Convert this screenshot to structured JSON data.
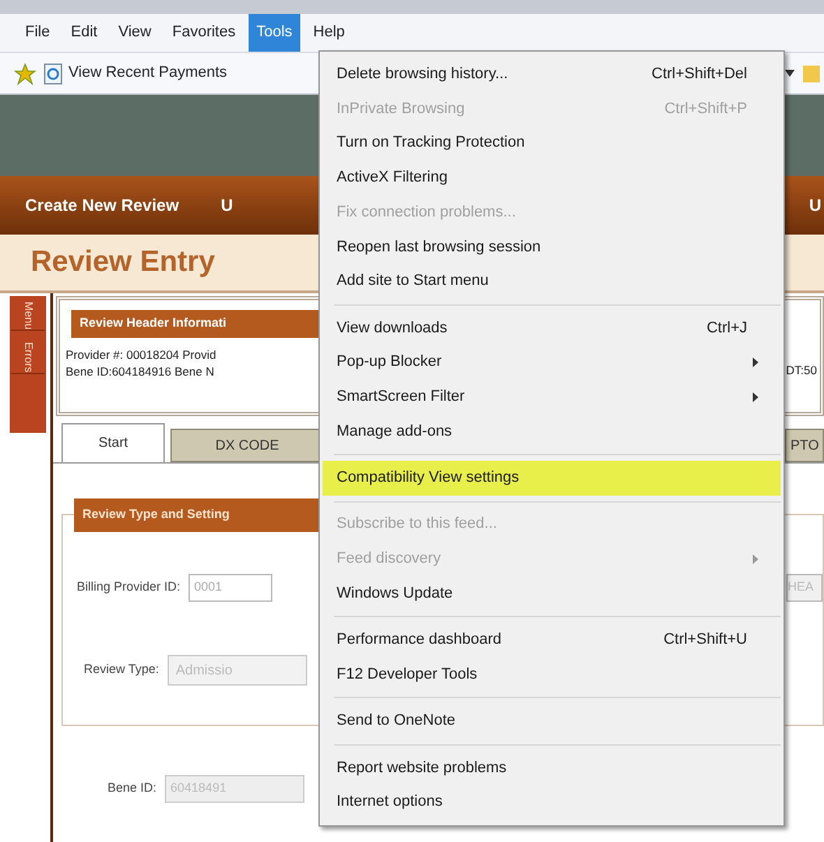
{
  "menu_bar": [
    {
      "label": "File",
      "selected": false
    },
    {
      "label": "Edit",
      "selected": false
    },
    {
      "label": "View",
      "selected": false
    },
    {
      "label": "Favorites",
      "selected": false
    },
    {
      "label": "Tools",
      "selected": true
    },
    {
      "label": "Help",
      "selected": false
    }
  ],
  "toolbar": {
    "link": "View Recent Payments"
  },
  "nav_bar": {
    "items": [
      "Create New Review",
      "U"
    ],
    "right_item": "U"
  },
  "page_title": "Review Entry",
  "side_tabs": [
    "Menu",
    "Errors"
  ],
  "header_panel": {
    "title": "Review Header Informati",
    "lines": [
      "Provider #: 00018204 Provid",
      "Bene ID:604184916 Bene N"
    ],
    "right_text": "DT:50"
  },
  "tabs": [
    {
      "label": "Start",
      "selected": true
    },
    {
      "label": "DX CODE",
      "selected": false
    }
  ],
  "right_tab": "PTO",
  "review_type_panel": {
    "title": "Review Type and Setting",
    "billing_provider": {
      "label": "Billing Provider ID:",
      "value": "0001"
    },
    "right_field_value": "HEA",
    "review_type": {
      "label": "Review Type:",
      "value": "Admissio"
    }
  },
  "bene_id": {
    "label": "Bene ID:",
    "value": "60418491"
  },
  "tools_menu": [
    {
      "kind": "item",
      "label": "Delete browsing history...",
      "shortcut": "Ctrl+Shift+Del",
      "disabled": false,
      "submenu": false,
      "selected": false
    },
    {
      "kind": "item",
      "label": "InPrivate Browsing",
      "shortcut": "Ctrl+Shift+P",
      "disabled": true,
      "submenu": false,
      "selected": false
    },
    {
      "kind": "item",
      "label": "Turn on Tracking Protection",
      "disabled": false,
      "submenu": false,
      "selected": false
    },
    {
      "kind": "item",
      "label": "ActiveX Filtering",
      "disabled": false,
      "submenu": false,
      "selected": false
    },
    {
      "kind": "item",
      "label": "Fix connection problems...",
      "disabled": true,
      "submenu": false,
      "selected": false
    },
    {
      "kind": "item",
      "label": "Reopen last browsing session",
      "disabled": false,
      "submenu": false,
      "selected": false
    },
    {
      "kind": "item",
      "label": "Add site to Start menu",
      "disabled": false,
      "submenu": false,
      "selected": false
    },
    {
      "kind": "separator"
    },
    {
      "kind": "item",
      "label": "View downloads",
      "shortcut": "Ctrl+J",
      "disabled": false,
      "submenu": false,
      "selected": false
    },
    {
      "kind": "item",
      "label": "Pop-up Blocker",
      "disabled": false,
      "submenu": true,
      "selected": false
    },
    {
      "kind": "item",
      "label": "SmartScreen Filter",
      "disabled": false,
      "submenu": true,
      "selected": false
    },
    {
      "kind": "item",
      "label": "Manage add-ons",
      "disabled": false,
      "submenu": false,
      "selected": false
    },
    {
      "kind": "separator"
    },
    {
      "kind": "item",
      "label": "Compatibility View settings",
      "disabled": false,
      "submenu": false,
      "selected": true
    },
    {
      "kind": "separator"
    },
    {
      "kind": "item",
      "label": "Subscribe to this feed...",
      "disabled": true,
      "submenu": false,
      "selected": false
    },
    {
      "kind": "item",
      "label": "Feed discovery",
      "disabled": true,
      "submenu": true,
      "selected": false
    },
    {
      "kind": "item",
      "label": "Windows Update",
      "disabled": false,
      "submenu": false,
      "selected": false
    },
    {
      "kind": "separator"
    },
    {
      "kind": "item",
      "label": "Performance dashboard",
      "shortcut": "Ctrl+Shift+U",
      "disabled": false,
      "submenu": false,
      "selected": false
    },
    {
      "kind": "item",
      "label": "F12 Developer Tools",
      "disabled": false,
      "submenu": false,
      "selected": false
    },
    {
      "kind": "separator"
    },
    {
      "kind": "item",
      "label": "Send to OneNote",
      "disabled": false,
      "submenu": false,
      "selected": false
    },
    {
      "kind": "separator"
    },
    {
      "kind": "item",
      "label": "Report website problems",
      "disabled": false,
      "submenu": false,
      "selected": false
    },
    {
      "kind": "item",
      "label": "Internet options",
      "disabled": false,
      "submenu": false,
      "selected": false
    }
  ]
}
